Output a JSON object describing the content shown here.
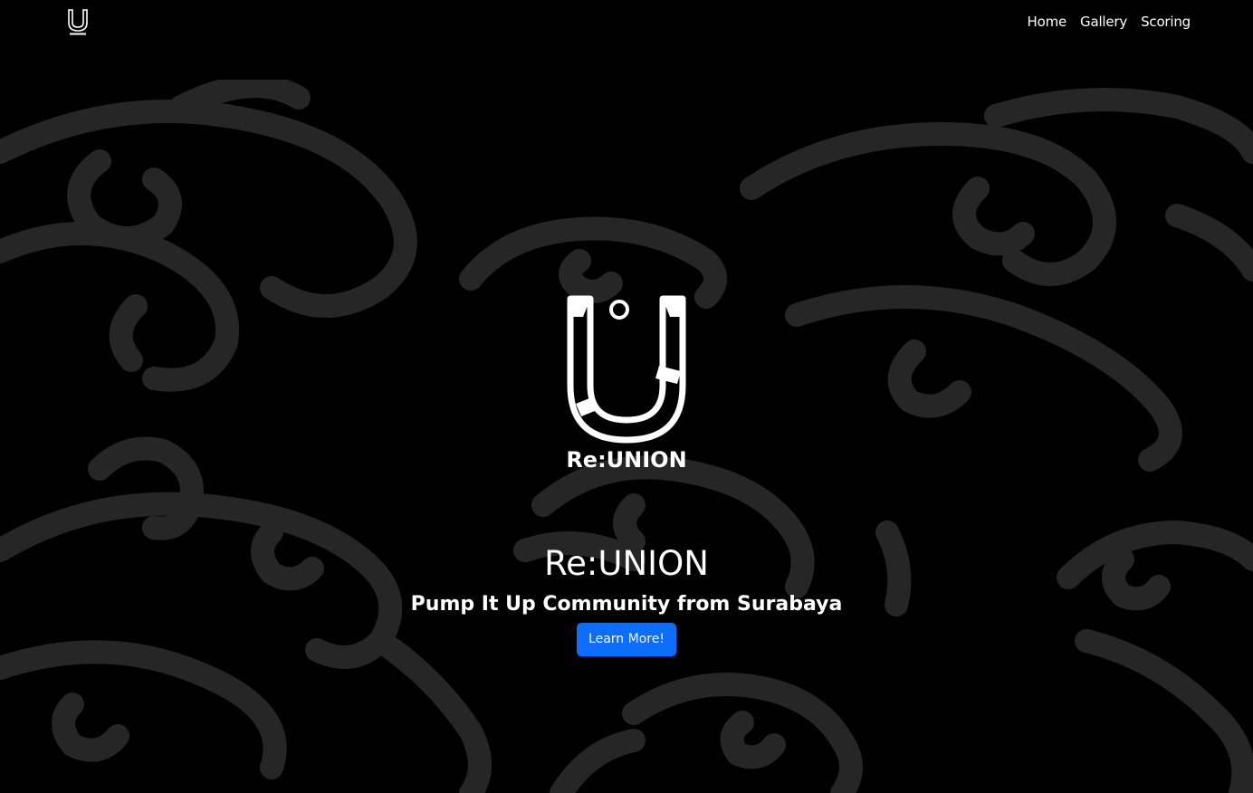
{
  "nav": {
    "logo_icon": "reunion-logo-icon",
    "links": [
      {
        "label": "Home"
      },
      {
        "label": "Gallery"
      },
      {
        "label": "Scoring"
      }
    ]
  },
  "hero": {
    "logo_text": "Re:UNION",
    "title": "Re:UNION",
    "subtitle": "Pump It Up Community from Surabaya",
    "cta_label": "Learn More!"
  },
  "colors": {
    "background": "#000000",
    "pattern": "#262626",
    "accent": "#0d6efd",
    "text": "#ffffff"
  }
}
